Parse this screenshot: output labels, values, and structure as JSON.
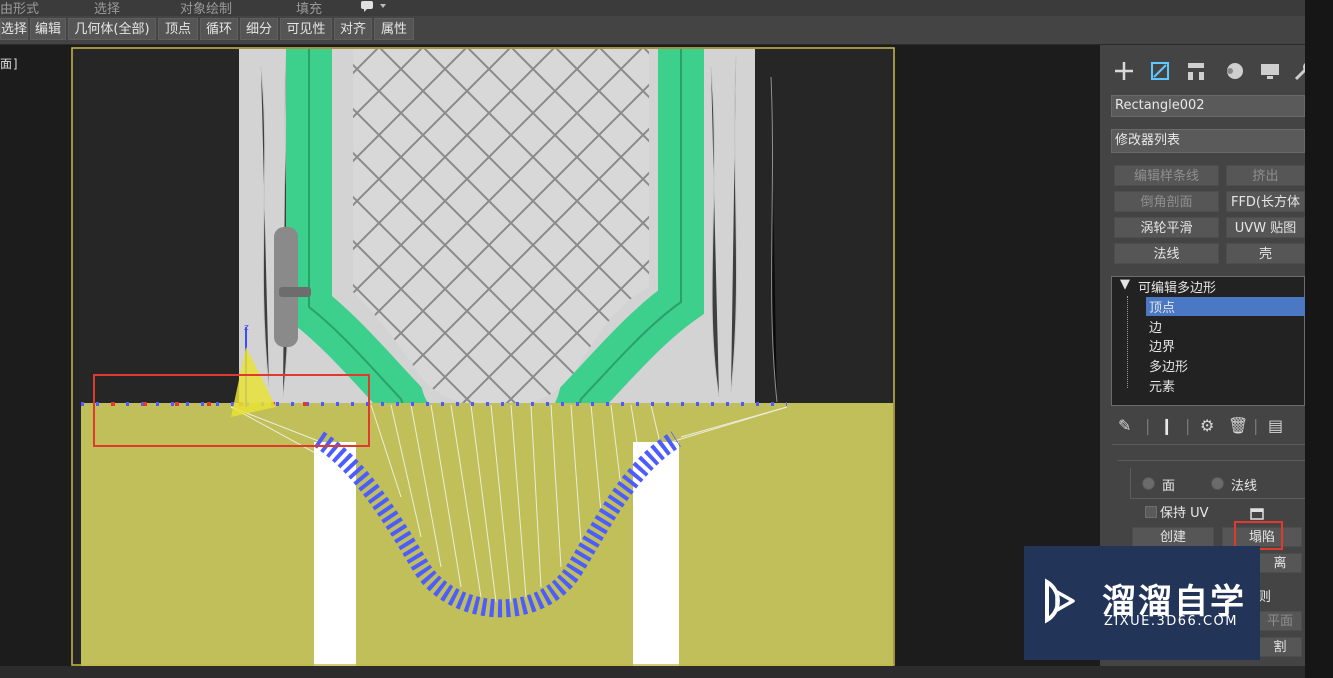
{
  "ribbon": {
    "tabs": [
      "由形式",
      "选择",
      "对象绘制",
      "填充"
    ],
    "menu_icon": "speech-bubble-dropdown-icon"
  },
  "subobject_toolbar": {
    "buttons": [
      "选择",
      "编辑",
      "几何体(全部)",
      "顶点",
      "循环",
      "细分",
      "可见性",
      "对齐",
      "属性"
    ]
  },
  "viewport": {
    "label": "面]"
  },
  "command_panel": {
    "tab_icons": [
      "create-plus-icon",
      "modify-icon",
      "hierarchy-icon",
      "motion-icon",
      "display-icon",
      "utilities-wrench-icon"
    ],
    "object_name": "Rectangle002",
    "modifier_list_label": "修改器列表",
    "modifier_buttons": [
      "编辑样条线",
      "挤出",
      "倒角剖面",
      "FFD(长方体",
      "涡轮平滑",
      "UVW 贴图",
      "法线",
      "壳"
    ],
    "stack": {
      "root": "可编辑多边形",
      "items": [
        "顶点",
        "边",
        "边界",
        "多边形",
        "元素"
      ],
      "selected": "顶点"
    },
    "stack_tool_icons": [
      "pin-stack-icon",
      "show-end-result-icon",
      "make-unique-icon",
      "remove-modifier-icon",
      "configure-modifier-sets-icon"
    ],
    "selection": {
      "radio_face": "面",
      "radio_normal": "法线",
      "preserve_uv": "保持 UV",
      "create_button": "创建",
      "collapse_button": "塌陷",
      "detach_partial": "离",
      "partial_line1": "则",
      "partial_plane": "平面",
      "partial_cut": "割"
    }
  },
  "watermark": {
    "title": "溜溜自学",
    "url": "ZIXUE.3D66.COM"
  },
  "colors": {
    "highlight_box": "#e03a2f",
    "door_trim": "#3dcf8c",
    "fill_plane": "#c0bf5a",
    "vertices": "#4d5cff",
    "selected_item": "#4a78c4"
  }
}
